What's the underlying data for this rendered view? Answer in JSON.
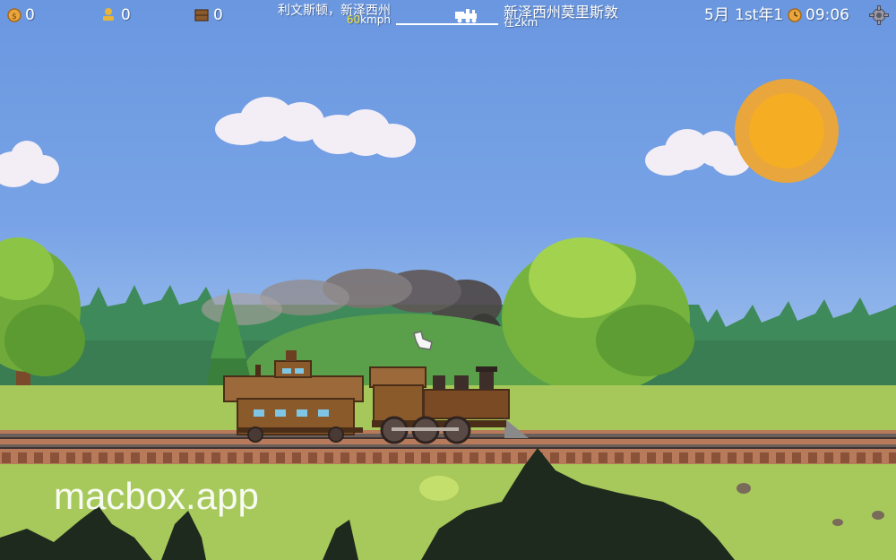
{
  "hud": {
    "coins": "0",
    "passengers": "0",
    "cargo": "0",
    "route_from": "利文斯顿，新泽西州",
    "speed_value": "60",
    "speed_unit": "kmph",
    "route_to": "新泽西州莫里斯敦",
    "distance": "在2km",
    "month": "5月",
    "date": "1st年1",
    "time": "09:06"
  },
  "icons": {
    "coins": "coin-icon",
    "passengers": "passenger-icon",
    "cargo": "cargo-crate-icon",
    "time": "clock-icon",
    "settings": "gear-icon",
    "route_marker": "train-icon"
  },
  "colors": {
    "sky": "#6a97e0",
    "sun": "#f5ad24",
    "grass": "#a7c95c",
    "train_body": "#8b5a2b",
    "speed_highlight": "#f4e43a"
  },
  "watermark": "macbox.app"
}
